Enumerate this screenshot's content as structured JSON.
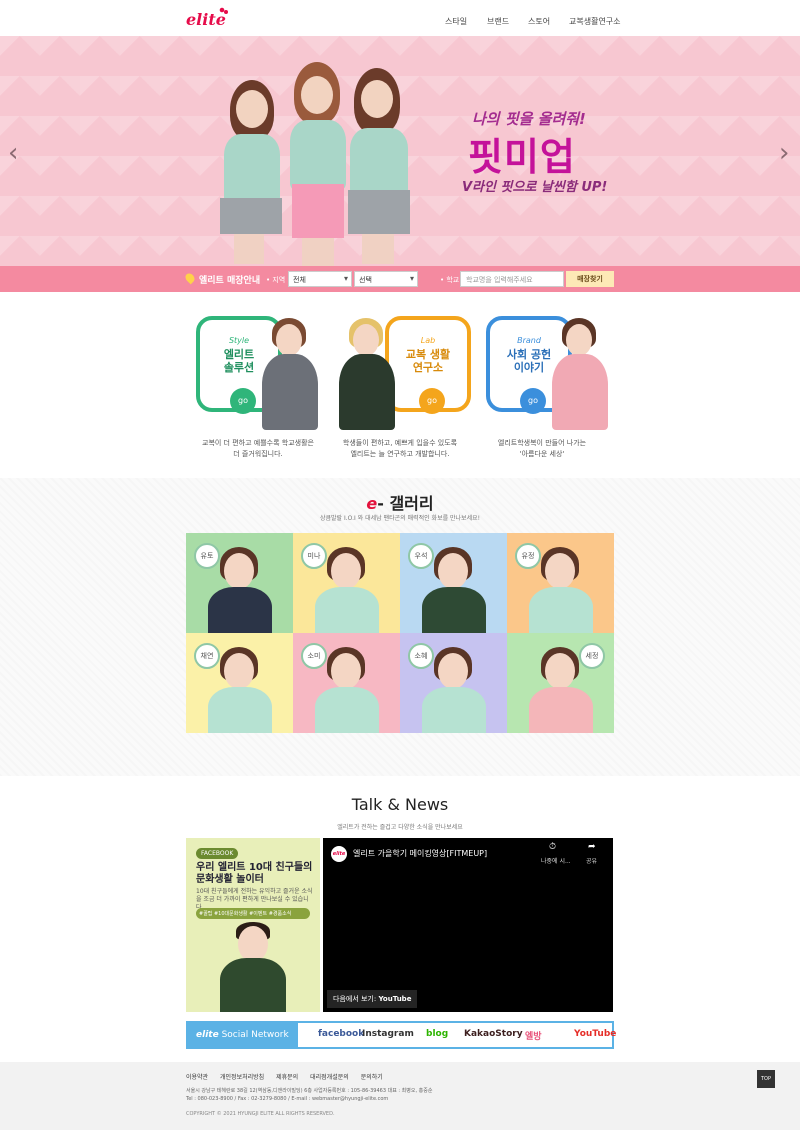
{
  "header": {
    "logo": "elite",
    "nav": [
      "스타일",
      "브랜드",
      "스토어",
      "교복생활연구소"
    ]
  },
  "hero": {
    "tagline": "나의 핏을 올려줘!",
    "title": "핏미업",
    "subtitle": "V라인 핏으로 날씬함 UP!",
    "prev": "‹",
    "next": "›"
  },
  "store": {
    "label": "엘리트 매장안내",
    "region_label": "• 지역",
    "region_value": "전체",
    "district_value": "선택",
    "school_label": "• 학교",
    "school_placeholder": "학교명을 입력해주세요",
    "search_button": "매장찾기"
  },
  "features": [
    {
      "kicker": "Style",
      "title": "엘리트\n솔루션",
      "go": "go",
      "desc": "교복이 더 편하고 예쁠수록 학교생활은\n더 즐거워집니다.",
      "color": "#2fb57a"
    },
    {
      "kicker": "Lab",
      "title": "교복 생활\n연구소",
      "go": "go",
      "desc": "학생들이 편하고, 예쁘게 입을수 있도록\n엘리트는 늘 연구하고 개발합니다.",
      "color": "#f4a51c"
    },
    {
      "kicker": "Brand",
      "title": "사회 공헌\n이야기",
      "go": "go",
      "desc": "엘리트학생복이 만들어 나가는\n'아름다운 세상'",
      "color": "#3b8fdc"
    }
  ],
  "gallery": {
    "title_e": "e",
    "title_rest": "- 갤러리",
    "subtitle": "상큼발랄 I.O.I 와 대세남 팬타곤의 매력적인 화보를 만나보세요!",
    "tiles": [
      {
        "name": "유토",
        "bg": "#a8dca6",
        "uniform": "#2b3447"
      },
      {
        "name": "미나",
        "bg": "#fbe79a",
        "uniform": "#b6e2d2"
      },
      {
        "name": "우석",
        "bg": "#b9d9f2",
        "uniform": "#2e4a34"
      },
      {
        "name": "유정",
        "bg": "#fbc78a",
        "uniform": "#b6e2d2"
      },
      {
        "name": "채연",
        "bg": "#fbf1a8",
        "uniform": "#b6e2d2"
      },
      {
        "name": "소미",
        "bg": "#f7b8c3",
        "uniform": "#b6e2d2"
      },
      {
        "name": "소혜",
        "bg": "#c6c3f0",
        "uniform": "#b6e2d2"
      },
      {
        "name": "세정",
        "bg": "#b7e6b0",
        "uniform": "#f4b6b9"
      }
    ]
  },
  "talk": {
    "title": "Talk & News",
    "subtitle": "엘리트가 전하는 즐겁고 다양한 소식을 만나보세요",
    "facebook": {
      "tag": "FACEBOOK",
      "title": "우리 엘리트 10대 친구들의 문화생활 놀이터",
      "desc": "10대 친구들에게 전하는 유익하고 즐거운 소식을 조금 더 가까이 편하게 만나보실 수 있습니다",
      "hashtags": "#꿀팁 #10대문화생활 #이벤트 #경품소식"
    },
    "video": {
      "channel": "elite",
      "title": "엘리트 가을학기 메이킹영상[FITMEUP]",
      "later": "나중에 시...",
      "share": "공유",
      "watch_prefix": "다음에서 보기:",
      "watch_brand": "YouTube"
    },
    "social": {
      "lead_brand": "elite",
      "lead_text": "Social Network",
      "items": [
        {
          "label": "facebook",
          "color": "#3b5998"
        },
        {
          "label": "Instagram",
          "color": "#333333"
        },
        {
          "label": "blog",
          "color": "#2db400"
        },
        {
          "label": "KakaoStory",
          "color": "#3c1e1e"
        },
        {
          "label": "엘방",
          "color": "#e8527a"
        },
        {
          "label": "YouTube",
          "color": "#e52d27"
        }
      ]
    }
  },
  "footer": {
    "links": [
      "이용약관",
      "개인정보처리방침",
      "제휴문의",
      "대리점개설문의",
      "문의하기"
    ],
    "address1": "서울시 강남구 테헤란로 38길 12(역삼동,디앤라이빌딩) 6층 사업자등록번호 : 105-86-39463 대표 : 최병오, 홍중순",
    "address2": "Tel : 080-023-8900 / Fax : 02-3279-8080 / E-mail : webmaster@hyungji-elite.com",
    "copyright": "COPYRIGHT © 2021 HYUNGJI ELITE ALL RIGHTS RESERVED.",
    "top": "TOP"
  }
}
